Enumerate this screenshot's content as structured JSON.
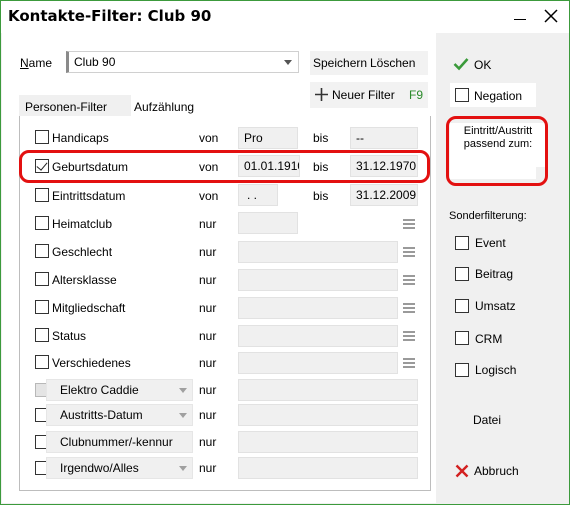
{
  "window": {
    "title": "Kontakte-Filter: Club 90"
  },
  "name_row": {
    "label": "Name",
    "value": "Club 90",
    "save_label": "Speichern",
    "delete_label": "Löschen"
  },
  "new_filter": {
    "label": "Neuer Filter",
    "shortcut": "F9"
  },
  "tabs": [
    {
      "label": "Personen-Filter"
    },
    {
      "label": "Aufzählung"
    }
  ],
  "filters": [
    {
      "label": "Handicaps",
      "op": "von",
      "from": "Pro",
      "to_op": "bis",
      "to": "--",
      "checked": false
    },
    {
      "label": "Geburtsdatum",
      "op": "von",
      "from": "01.01.1910",
      "to_op": "bis",
      "to": "31.12.1970",
      "checked": true
    },
    {
      "label": "Eintrittsdatum",
      "op": "von",
      "from": " .  .",
      "to_op": "bis",
      "to": "31.12.2009",
      "checked": false
    },
    {
      "label": "Heimatclub",
      "op": "nur",
      "checked": false
    },
    {
      "label": "Geschlecht",
      "op": "nur",
      "checked": false
    },
    {
      "label": "Altersklasse",
      "op": "nur",
      "checked": false
    },
    {
      "label": "Mitgliedschaft",
      "op": "nur",
      "checked": false
    },
    {
      "label": "Status",
      "op": "nur",
      "checked": false
    },
    {
      "label": "Verschiedenes",
      "op": "nur",
      "checked": false
    }
  ],
  "custom_filters": [
    {
      "label": "Elektro Caddie",
      "op": "nur"
    },
    {
      "label": "Austritts-Datum",
      "op": "nur"
    },
    {
      "label": "Clubnummer/-kennur",
      "op": "nur"
    },
    {
      "label": "Irgendwo/Alles",
      "op": "nur"
    }
  ],
  "right": {
    "ok_label": "OK",
    "negation_label": "Negation",
    "eintritt_label": "Eintritt/Austritt passend zum:",
    "eintritt_value": "",
    "sonder_label": "Sonderfilterung:",
    "special_filters": [
      {
        "label": "Event"
      },
      {
        "label": "Beitrag"
      },
      {
        "label": "Umsatz"
      },
      {
        "label": "CRM"
      },
      {
        "label": "Logisch"
      }
    ],
    "datei_label": "Datei",
    "abbruch_label": "Abbruch"
  },
  "colors": {
    "highlight": "#e31010",
    "ok_green": "#3a9a3a",
    "cancel_red": "#d32020",
    "border_green": "#3c9a3c"
  }
}
